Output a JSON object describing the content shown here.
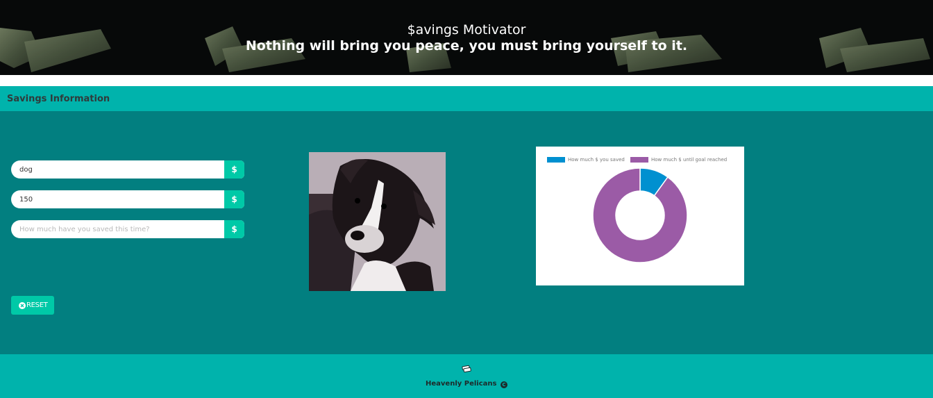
{
  "header": {
    "title": "$avings Motivator",
    "subtitle": "Nothing will bring you peace, you must bring yourself to it."
  },
  "section": {
    "title": "Savings Information"
  },
  "form": {
    "goal_item": {
      "value": "dog",
      "addon": "$"
    },
    "goal_amount": {
      "value": "150",
      "addon": "$"
    },
    "saved_amount": {
      "value": "",
      "placeholder": "How much have you saved this time?",
      "addon": "$"
    },
    "reset_label": "RESET"
  },
  "chart_data": {
    "type": "pie",
    "variant": "doughnut",
    "legend_position": "top",
    "labels": [
      "How much $ you saved",
      "How much $ until goal reached"
    ],
    "values": [
      10,
      90
    ],
    "colors": [
      "#0090d0",
      "#9b5ba6"
    ]
  },
  "footer": {
    "credit": "Heavenly Pelicans",
    "copyright_glyph": "C"
  },
  "icons": {
    "addon_icon": "dollar-icon",
    "reset_icon": "close-circle-icon",
    "footer_icon": "money-icon",
    "copyright_icon": "copyright-icon"
  }
}
